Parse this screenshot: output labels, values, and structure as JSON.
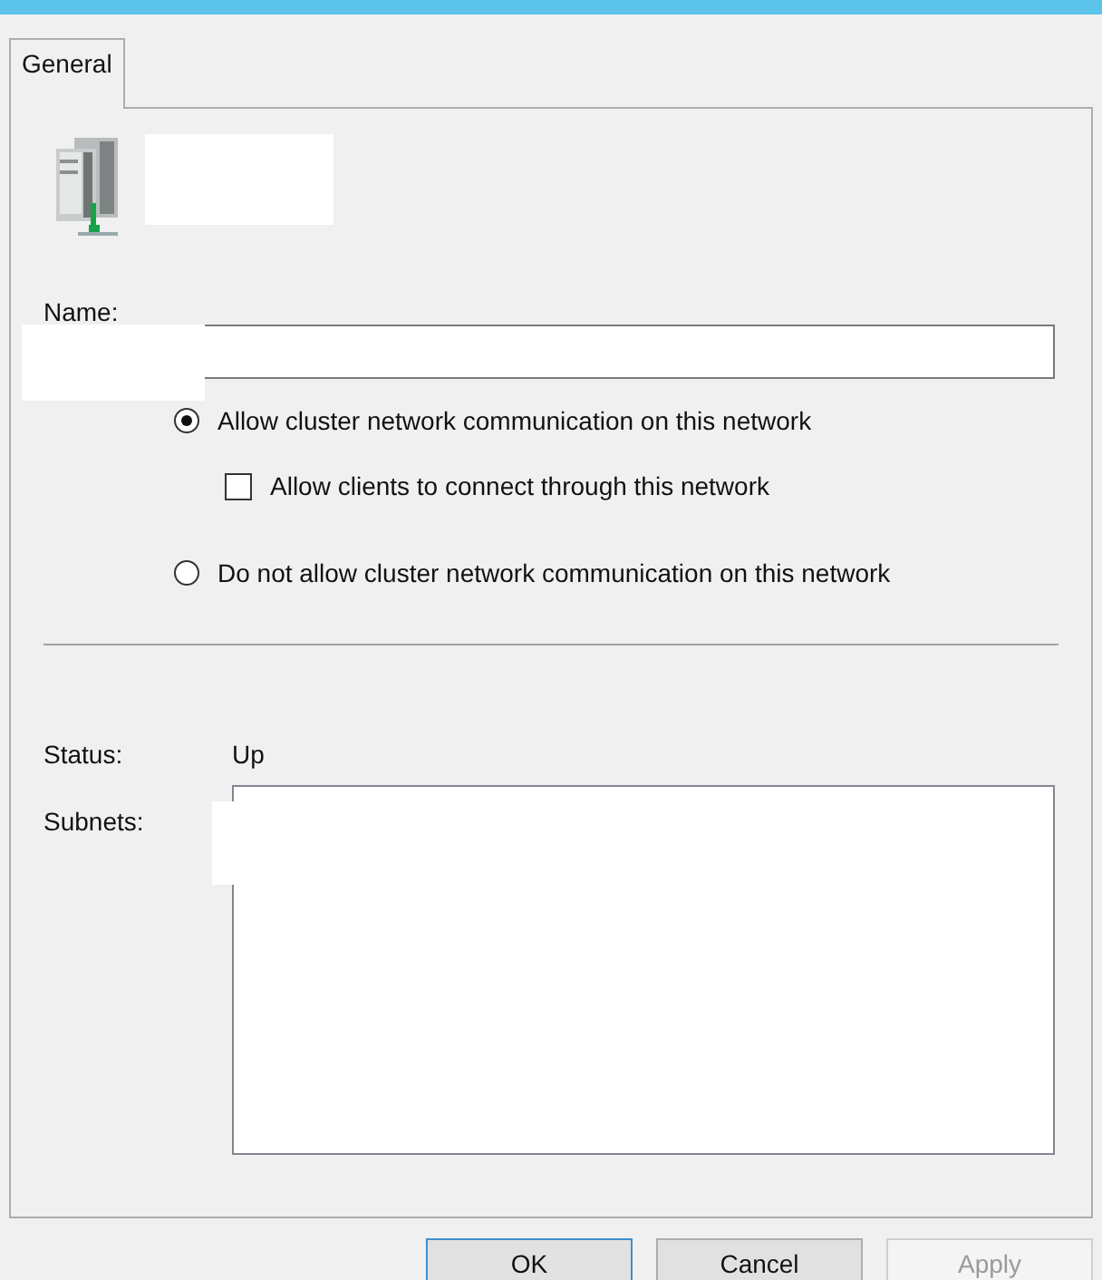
{
  "tabs": [
    {
      "label": "General",
      "selected": true
    }
  ],
  "name_field": {
    "label": "Name:"
  },
  "options": [
    {
      "kind": "radio",
      "label": "Allow cluster network communication on this network",
      "selected": true
    },
    {
      "kind": "checkbox",
      "label": "Allow clients to connect through this network",
      "checked": false
    },
    {
      "kind": "radio",
      "label": "Do not allow cluster network communication on this network",
      "selected": false
    }
  ],
  "status": {
    "label": "Status:",
    "value": "Up"
  },
  "subnets": {
    "label": "Subnets:"
  },
  "buttons": [
    {
      "label": "OK",
      "disabled": false,
      "default": true
    },
    {
      "label": "Cancel",
      "disabled": false,
      "default": false
    },
    {
      "label": "Apply",
      "disabled": true,
      "default": false
    }
  ]
}
